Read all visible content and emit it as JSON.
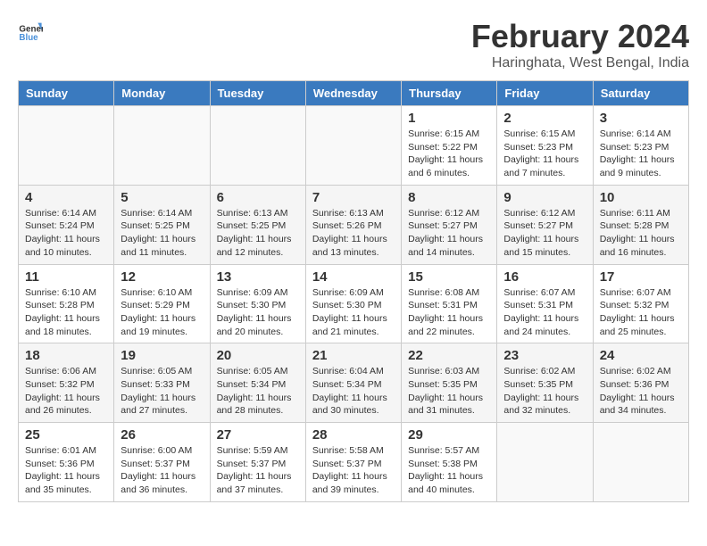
{
  "header": {
    "logo_line1": "General",
    "logo_line2": "Blue",
    "month_year": "February 2024",
    "location": "Haringhata, West Bengal, India"
  },
  "days_of_week": [
    "Sunday",
    "Monday",
    "Tuesday",
    "Wednesday",
    "Thursday",
    "Friday",
    "Saturday"
  ],
  "weeks": [
    [
      {
        "day": "",
        "empty": true
      },
      {
        "day": "",
        "empty": true
      },
      {
        "day": "",
        "empty": true
      },
      {
        "day": "",
        "empty": true
      },
      {
        "day": "1",
        "sunrise": "6:15 AM",
        "sunset": "5:22 PM",
        "daylight": "11 hours and 6 minutes."
      },
      {
        "day": "2",
        "sunrise": "6:15 AM",
        "sunset": "5:23 PM",
        "daylight": "11 hours and 7 minutes."
      },
      {
        "day": "3",
        "sunrise": "6:14 AM",
        "sunset": "5:23 PM",
        "daylight": "11 hours and 9 minutes."
      }
    ],
    [
      {
        "day": "4",
        "sunrise": "6:14 AM",
        "sunset": "5:24 PM",
        "daylight": "11 hours and 10 minutes."
      },
      {
        "day": "5",
        "sunrise": "6:14 AM",
        "sunset": "5:25 PM",
        "daylight": "11 hours and 11 minutes."
      },
      {
        "day": "6",
        "sunrise": "6:13 AM",
        "sunset": "5:25 PM",
        "daylight": "11 hours and 12 minutes."
      },
      {
        "day": "7",
        "sunrise": "6:13 AM",
        "sunset": "5:26 PM",
        "daylight": "11 hours and 13 minutes."
      },
      {
        "day": "8",
        "sunrise": "6:12 AM",
        "sunset": "5:27 PM",
        "daylight": "11 hours and 14 minutes."
      },
      {
        "day": "9",
        "sunrise": "6:12 AM",
        "sunset": "5:27 PM",
        "daylight": "11 hours and 15 minutes."
      },
      {
        "day": "10",
        "sunrise": "6:11 AM",
        "sunset": "5:28 PM",
        "daylight": "11 hours and 16 minutes."
      }
    ],
    [
      {
        "day": "11",
        "sunrise": "6:10 AM",
        "sunset": "5:28 PM",
        "daylight": "11 hours and 18 minutes."
      },
      {
        "day": "12",
        "sunrise": "6:10 AM",
        "sunset": "5:29 PM",
        "daylight": "11 hours and 19 minutes."
      },
      {
        "day": "13",
        "sunrise": "6:09 AM",
        "sunset": "5:30 PM",
        "daylight": "11 hours and 20 minutes."
      },
      {
        "day": "14",
        "sunrise": "6:09 AM",
        "sunset": "5:30 PM",
        "daylight": "11 hours and 21 minutes."
      },
      {
        "day": "15",
        "sunrise": "6:08 AM",
        "sunset": "5:31 PM",
        "daylight": "11 hours and 22 minutes."
      },
      {
        "day": "16",
        "sunrise": "6:07 AM",
        "sunset": "5:31 PM",
        "daylight": "11 hours and 24 minutes."
      },
      {
        "day": "17",
        "sunrise": "6:07 AM",
        "sunset": "5:32 PM",
        "daylight": "11 hours and 25 minutes."
      }
    ],
    [
      {
        "day": "18",
        "sunrise": "6:06 AM",
        "sunset": "5:32 PM",
        "daylight": "11 hours and 26 minutes."
      },
      {
        "day": "19",
        "sunrise": "6:05 AM",
        "sunset": "5:33 PM",
        "daylight": "11 hours and 27 minutes."
      },
      {
        "day": "20",
        "sunrise": "6:05 AM",
        "sunset": "5:34 PM",
        "daylight": "11 hours and 28 minutes."
      },
      {
        "day": "21",
        "sunrise": "6:04 AM",
        "sunset": "5:34 PM",
        "daylight": "11 hours and 30 minutes."
      },
      {
        "day": "22",
        "sunrise": "6:03 AM",
        "sunset": "5:35 PM",
        "daylight": "11 hours and 31 minutes."
      },
      {
        "day": "23",
        "sunrise": "6:02 AM",
        "sunset": "5:35 PM",
        "daylight": "11 hours and 32 minutes."
      },
      {
        "day": "24",
        "sunrise": "6:02 AM",
        "sunset": "5:36 PM",
        "daylight": "11 hours and 34 minutes."
      }
    ],
    [
      {
        "day": "25",
        "sunrise": "6:01 AM",
        "sunset": "5:36 PM",
        "daylight": "11 hours and 35 minutes."
      },
      {
        "day": "26",
        "sunrise": "6:00 AM",
        "sunset": "5:37 PM",
        "daylight": "11 hours and 36 minutes."
      },
      {
        "day": "27",
        "sunrise": "5:59 AM",
        "sunset": "5:37 PM",
        "daylight": "11 hours and 37 minutes."
      },
      {
        "day": "28",
        "sunrise": "5:58 AM",
        "sunset": "5:37 PM",
        "daylight": "11 hours and 39 minutes."
      },
      {
        "day": "29",
        "sunrise": "5:57 AM",
        "sunset": "5:38 PM",
        "daylight": "11 hours and 40 minutes."
      },
      {
        "day": "",
        "empty": true
      },
      {
        "day": "",
        "empty": true
      }
    ]
  ]
}
